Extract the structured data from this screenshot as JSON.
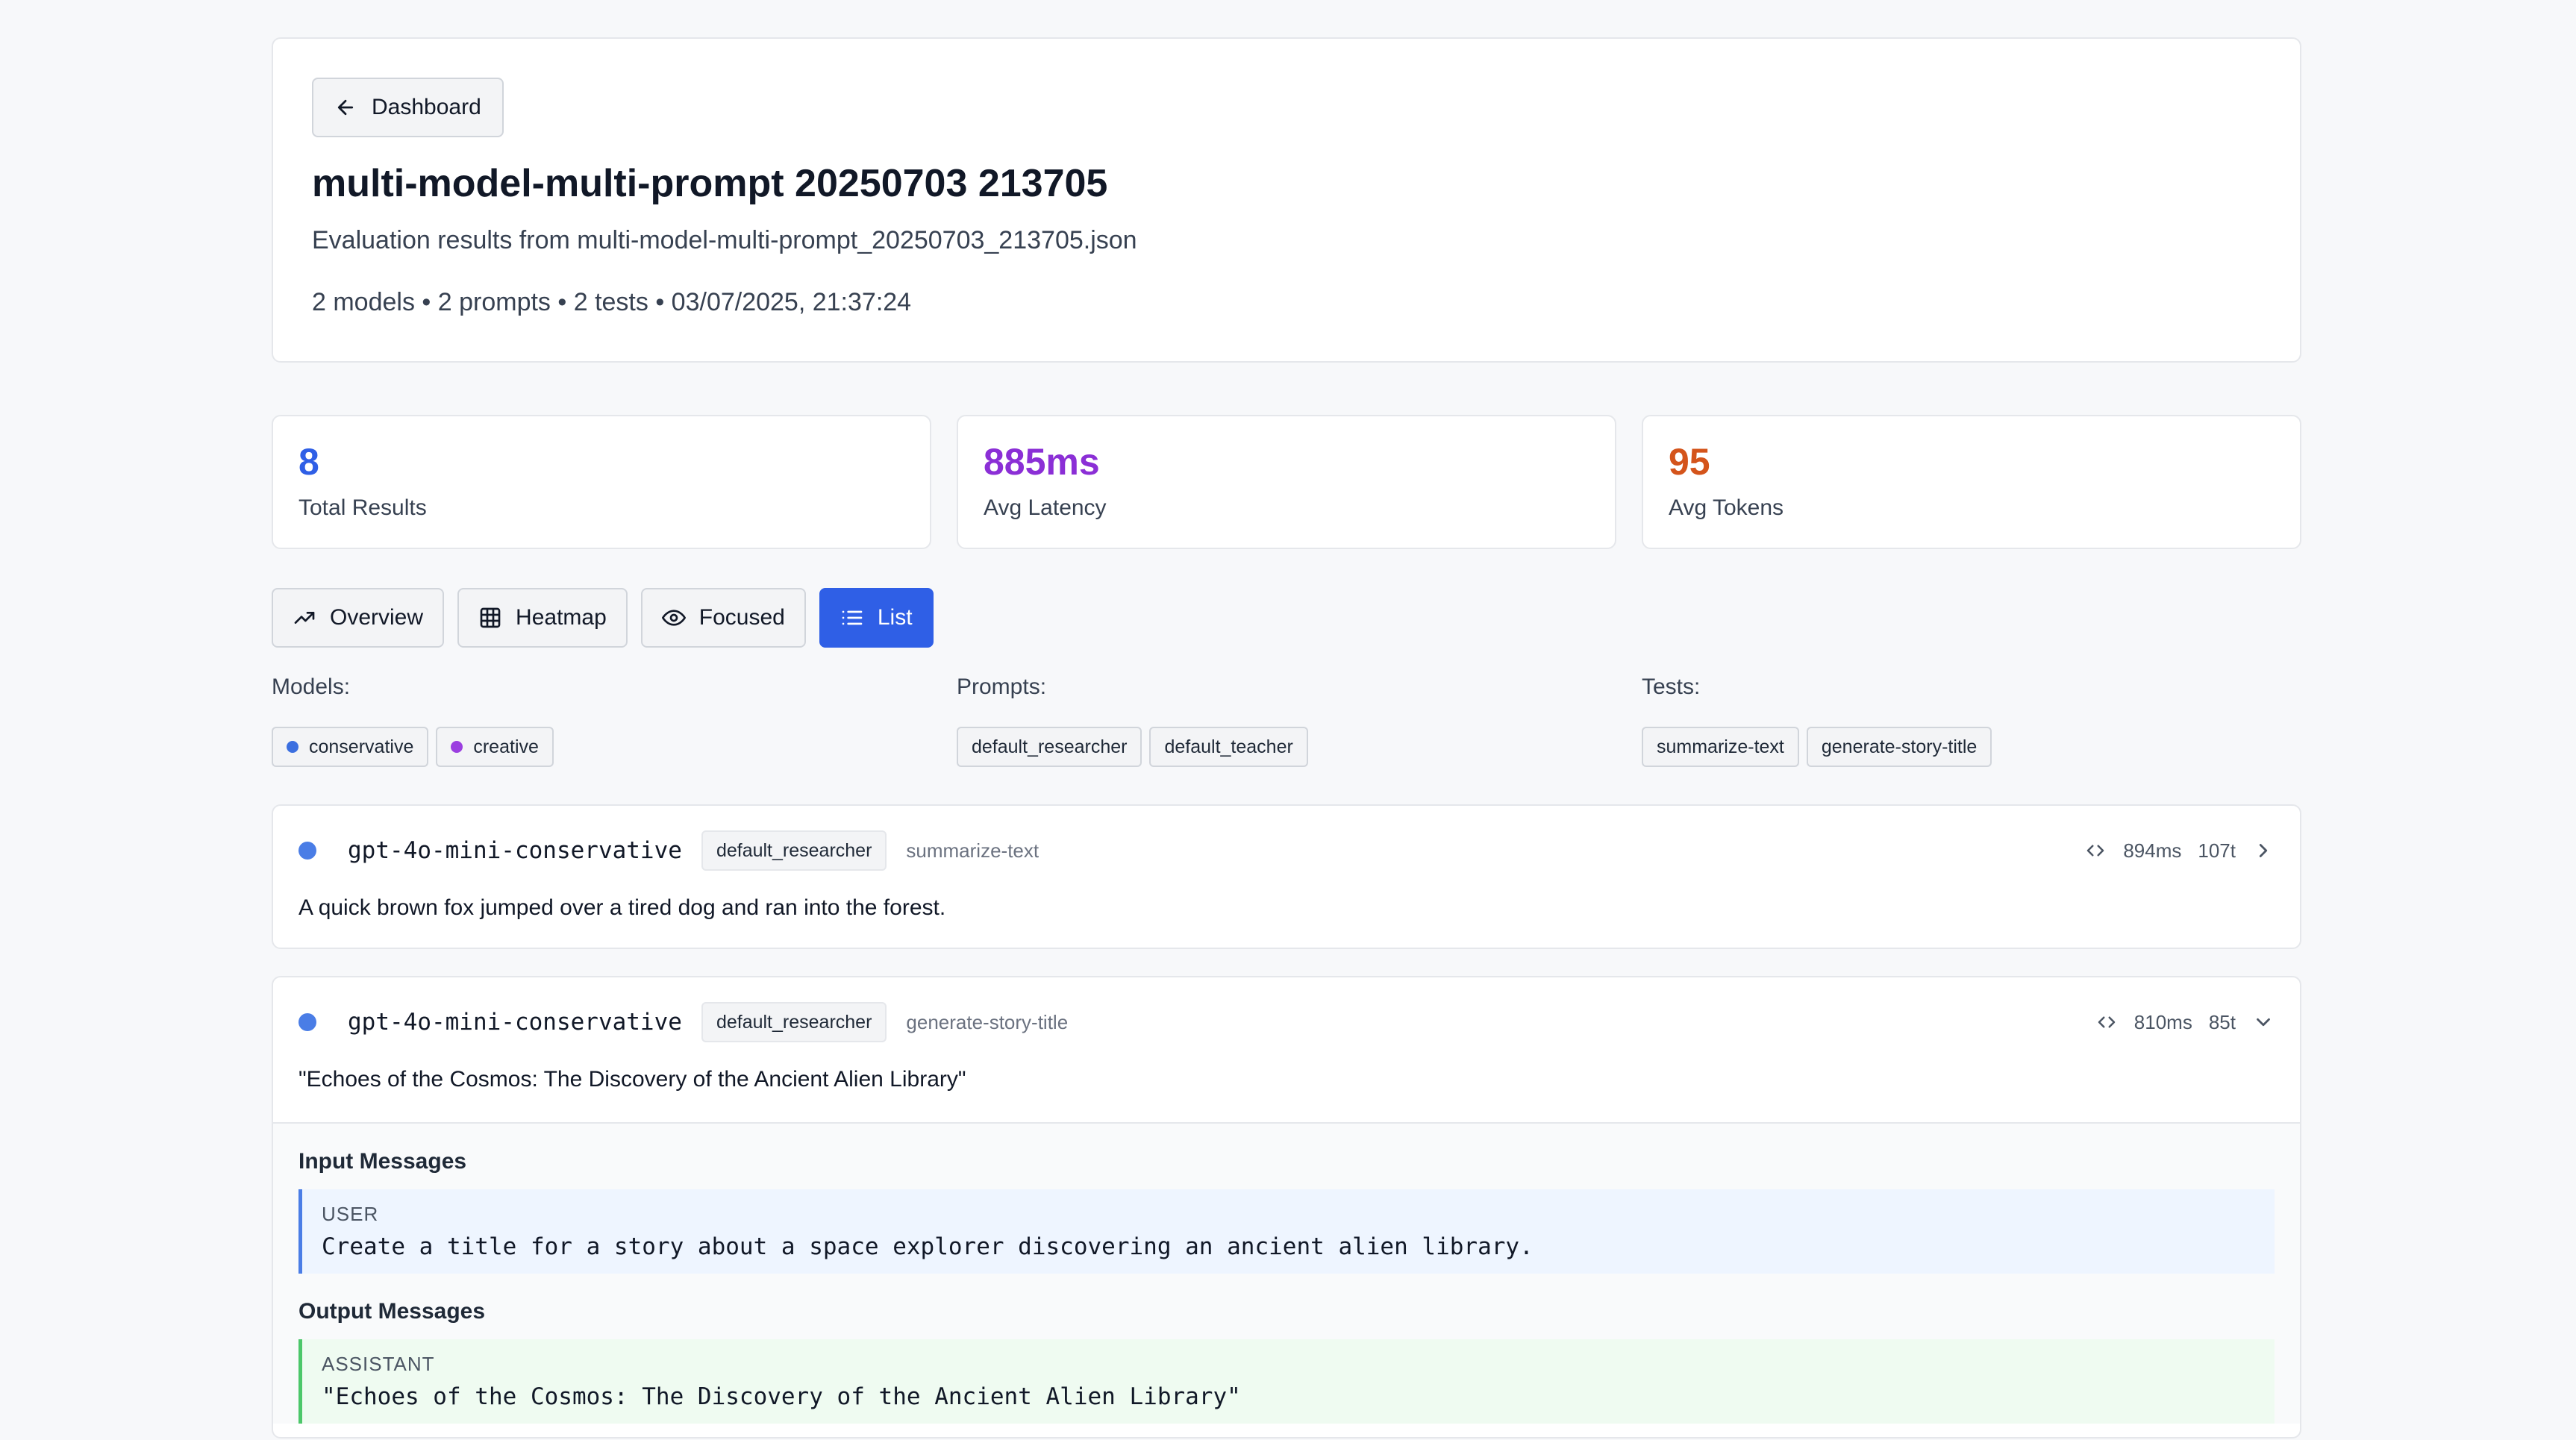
{
  "header": {
    "back_label": "Dashboard",
    "title": "multi-model-multi-prompt 20250703 213705",
    "subtitle": "Evaluation results from multi-model-multi-prompt_20250703_213705.json",
    "meta": "2 models • 2 prompts • 2 tests • 03/07/2025, 21:37:24"
  },
  "stats": [
    {
      "value": "8",
      "label": "Total Results",
      "color": "#2f5fe6"
    },
    {
      "value": "885ms",
      "label": "Avg Latency",
      "color": "#8b2fd6"
    },
    {
      "value": "95",
      "label": "Avg Tokens",
      "color": "#d4541b"
    }
  ],
  "tabs": [
    {
      "label": "Overview",
      "icon": "trending-up-icon"
    },
    {
      "label": "Heatmap",
      "icon": "grid-icon"
    },
    {
      "label": "Focused",
      "icon": "eye-icon"
    },
    {
      "label": "List",
      "icon": "list-icon",
      "active": true
    }
  ],
  "filters": {
    "models": {
      "label": "Models:",
      "chips": [
        {
          "label": "conservative",
          "color": "#3b6fe0"
        },
        {
          "label": "creative",
          "color": "#9b3fe0"
        }
      ]
    },
    "prompts": {
      "label": "Prompts:",
      "chips": [
        "default_researcher",
        "default_teacher"
      ]
    },
    "tests": {
      "label": "Tests:",
      "chips": [
        "summarize-text",
        "generate-story-title"
      ]
    }
  },
  "results": [
    {
      "model": "gpt-4o-mini-conservative",
      "prompt": "default_researcher",
      "test": "summarize-text",
      "latency": "894ms",
      "tokens": "107t",
      "output": "A quick brown fox jumped over a tired dog and ran into the forest.",
      "expanded": false
    },
    {
      "model": "gpt-4o-mini-conservative",
      "prompt": "default_researcher",
      "test": "generate-story-title",
      "latency": "810ms",
      "tokens": "85t",
      "output": "\"Echoes of the Cosmos: The Discovery of the Ancient Alien Library\"",
      "expanded": true,
      "input_heading": "Input Messages",
      "output_heading": "Output Messages",
      "input_messages": [
        {
          "role": "USER",
          "content": "Create a title for a story about a space explorer discovering an ancient alien library."
        }
      ],
      "output_messages": [
        {
          "role": "ASSISTANT",
          "content": "\"Echoes of the Cosmos: The Discovery of the Ancient Alien Library\""
        }
      ]
    }
  ]
}
